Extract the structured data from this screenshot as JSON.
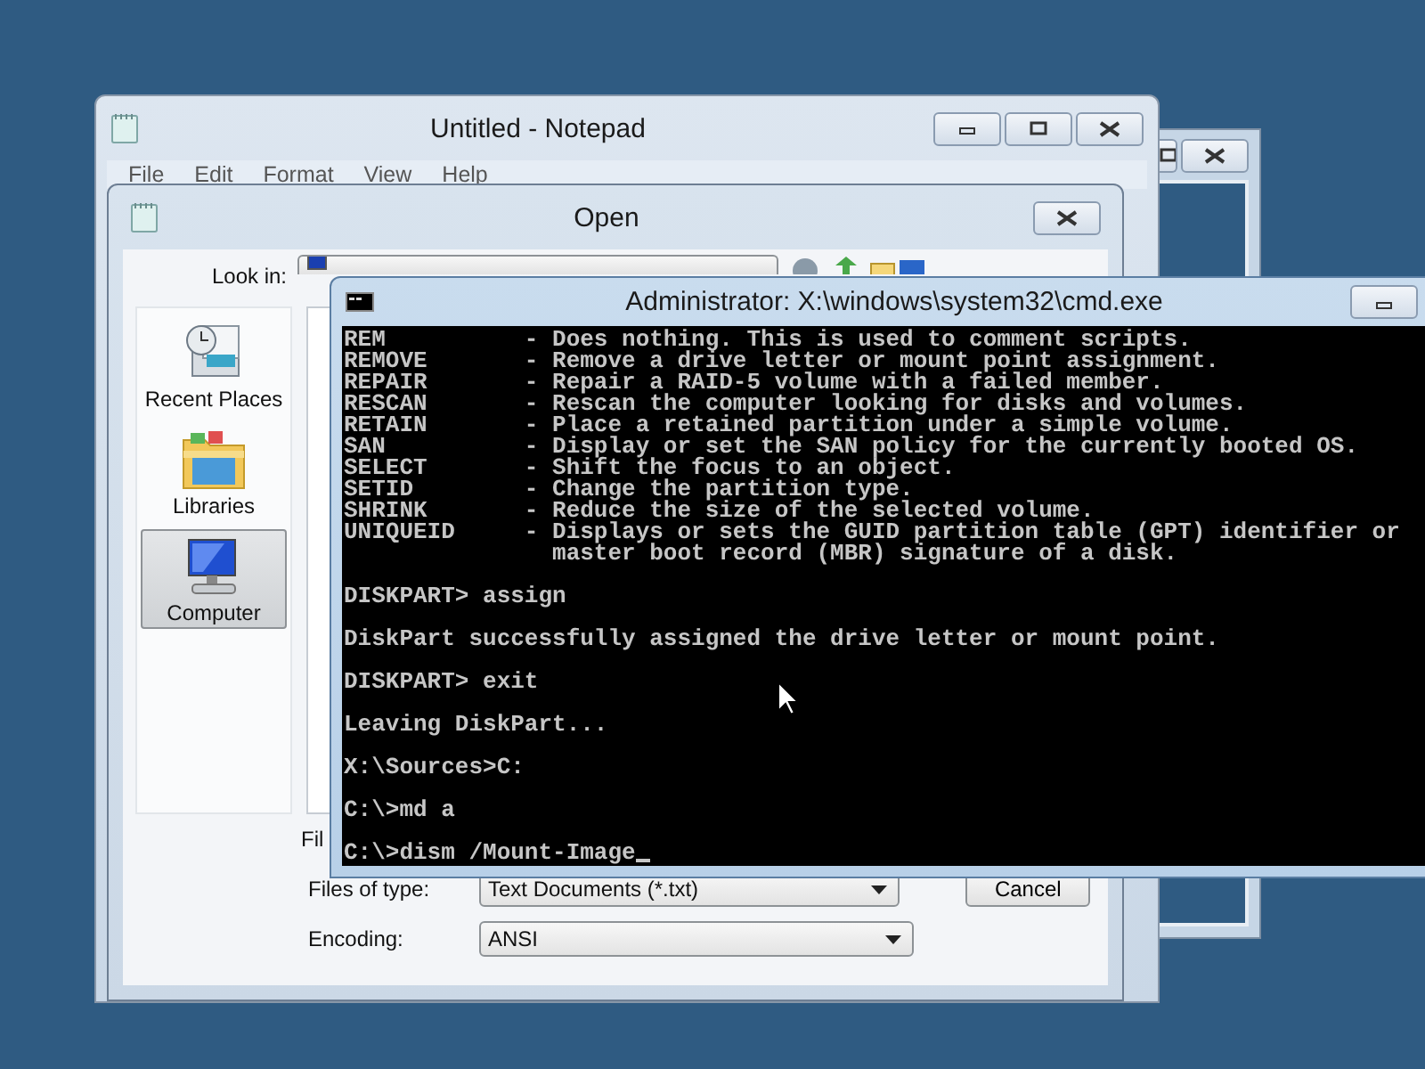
{
  "notepad": {
    "title": "Untitled - Notepad",
    "menu": [
      "File",
      "Edit",
      "Format",
      "View",
      "Help"
    ]
  },
  "open_dialog": {
    "title": "Open",
    "look_in_label": "Look in:",
    "places": [
      {
        "label": "Recent Places",
        "kind": "recent",
        "selected": false
      },
      {
        "label": "Libraries",
        "kind": "libraries",
        "selected": false
      },
      {
        "label": "Computer",
        "kind": "computer",
        "selected": true
      }
    ],
    "file_name_label": "Fil",
    "file_type": {
      "label": "Files of type:",
      "value": "Text Documents (*.txt)"
    },
    "encoding": {
      "label": "Encoding:",
      "value": "ANSI"
    },
    "cancel_button": "Cancel"
  },
  "cmd": {
    "title": "Administrator: X:\\windows\\system32\\cmd.exe",
    "blocks": [
      [
        "REM          - Does nothing. This is used to comment scripts.",
        "REMOVE       - Remove a drive letter or mount point assignment.",
        "REPAIR       - Repair a RAID-5 volume with a failed member.",
        "RESCAN       - Rescan the computer looking for disks and volumes.",
        "RETAIN       - Place a retained partition under a simple volume.",
        "SAN          - Display or set the SAN policy for the currently booted OS.",
        "SELECT       - Shift the focus to an object.",
        "SETID        - Change the partition type.",
        "SHRINK       - Reduce the size of the selected volume.",
        "UNIQUEID     - Displays or sets the GUID partition table (GPT) identifier or",
        "               master boot record (MBR) signature of a disk."
      ],
      [
        "DISKPART> assign"
      ],
      [
        "DiskPart successfully assigned the drive letter or mount point."
      ],
      [
        "DISKPART> exit"
      ],
      [
        "Leaving DiskPart..."
      ],
      [
        "X:\\Sources>C:"
      ],
      [
        "C:\\>md a"
      ],
      [
        "C:\\>dism /Mount-Image"
      ]
    ]
  }
}
